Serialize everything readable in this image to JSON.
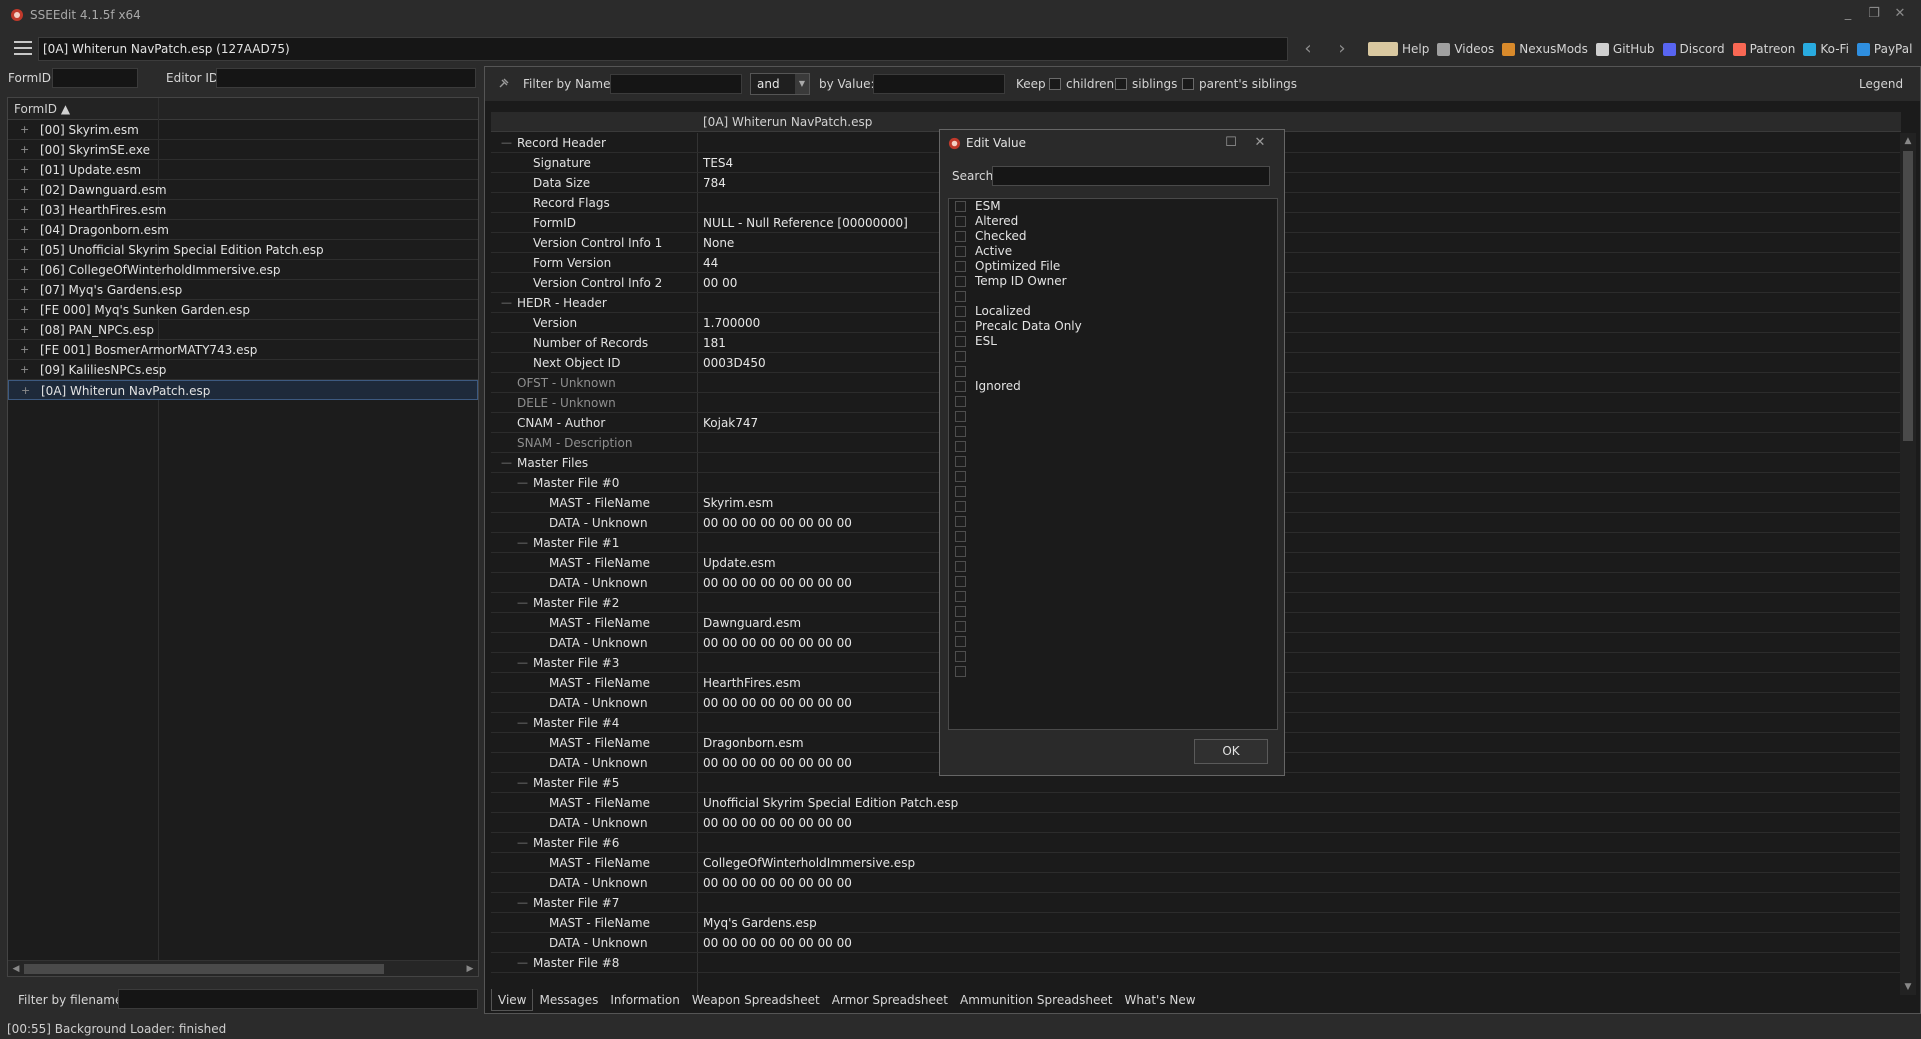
{
  "window": {
    "title": "SSEEdit 4.1.5f x64"
  },
  "toolbar": {
    "file_title": "[0A] Whiterun NavPatch.esp (127AAD75)",
    "links": [
      {
        "label": "Help",
        "icon": "book-icon",
        "color": "#d9c8a0"
      },
      {
        "label": "Videos",
        "icon": "video-icon",
        "color": "#a0a0a0"
      },
      {
        "label": "NexusMods",
        "icon": "nexus-icon",
        "color": "#d98a2b"
      },
      {
        "label": "GitHub",
        "icon": "github-icon",
        "color": "#cfcfcf"
      },
      {
        "label": "Discord",
        "icon": "discord-icon",
        "color": "#5865f2"
      },
      {
        "label": "Patreon",
        "icon": "patreon-icon",
        "color": "#f96854"
      },
      {
        "label": "Ko-Fi",
        "icon": "kofi-icon",
        "color": "#29abe0"
      },
      {
        "label": "PayPal",
        "icon": "paypal-icon",
        "color": "#2f8fe0"
      }
    ]
  },
  "left": {
    "formid_label": "FormID",
    "editorid_label": "Editor ID",
    "tree_header": "FormID ▲",
    "files": [
      "[00] Skyrim.esm",
      "[00] SkyrimSE.exe",
      "[01] Update.esm",
      "[02] Dawnguard.esm",
      "[03] HearthFires.esm",
      "[04] Dragonborn.esm",
      "[05] Unofficial Skyrim Special Edition Patch.esp",
      "[06] CollegeOfWinterholdImmersive.esp",
      "[07] Myq's Gardens.esp",
      "[FE 000] Myq's Sunken Garden.esp",
      "[08] PAN_NPCs.esp",
      "[FE 001] BosmerArmorMATY743.esp",
      "[09] KaliliesNPCs.esp",
      "[0A] Whiterun NavPatch.esp"
    ],
    "selected_index": 13,
    "filter_filename_label": "Filter by filename:"
  },
  "status": "[00:55] Background Loader: finished",
  "right": {
    "filter_by_name": "Filter by Name:",
    "combo_value": "and",
    "by_value": "by Value:",
    "keep": "Keep",
    "children": "children",
    "siblings": "siblings",
    "parents_siblings": "parent's siblings",
    "legend": "Legend",
    "column_header": "[0A] Whiterun NavPatch.esp",
    "rows": [
      {
        "label": "Record Header",
        "value": "",
        "indent": 0,
        "dim": false,
        "toggle": "—"
      },
      {
        "label": "Signature",
        "value": "TES4",
        "indent": 1,
        "dim": false,
        "toggle": ""
      },
      {
        "label": "Data Size",
        "value": "784",
        "indent": 1,
        "dim": false,
        "toggle": ""
      },
      {
        "label": "Record Flags",
        "value": "",
        "indent": 1,
        "dim": false,
        "toggle": ""
      },
      {
        "label": "FormID",
        "value": "NULL - Null Reference [00000000]",
        "indent": 1,
        "dim": false,
        "toggle": ""
      },
      {
        "label": "Version Control Info 1",
        "value": "None",
        "indent": 1,
        "dim": false,
        "toggle": ""
      },
      {
        "label": "Form Version",
        "value": "44",
        "indent": 1,
        "dim": false,
        "toggle": ""
      },
      {
        "label": "Version Control Info 2",
        "value": "00 00",
        "indent": 1,
        "dim": false,
        "toggle": ""
      },
      {
        "label": "HEDR - Header",
        "value": "",
        "indent": 0,
        "dim": false,
        "toggle": "—"
      },
      {
        "label": "Version",
        "value": "1.700000",
        "indent": 1,
        "dim": false,
        "toggle": ""
      },
      {
        "label": "Number of Records",
        "value": "181",
        "indent": 1,
        "dim": false,
        "toggle": ""
      },
      {
        "label": "Next Object ID",
        "value": "0003D450",
        "indent": 1,
        "dim": false,
        "toggle": ""
      },
      {
        "label": "OFST - Unknown",
        "value": "",
        "indent": 0,
        "dim": true,
        "toggle": ""
      },
      {
        "label": "DELE - Unknown",
        "value": "",
        "indent": 0,
        "dim": true,
        "toggle": ""
      },
      {
        "label": "CNAM - Author",
        "value": "Kojak747",
        "indent": 0,
        "dim": false,
        "toggle": ""
      },
      {
        "label": "SNAM - Description",
        "value": "",
        "indent": 0,
        "dim": true,
        "toggle": ""
      },
      {
        "label": "Master Files",
        "value": "",
        "indent": 0,
        "dim": false,
        "toggle": "—"
      },
      {
        "label": "Master File #0",
        "value": "",
        "indent": 1,
        "dim": false,
        "toggle": "—"
      },
      {
        "label": "MAST - FileName",
        "value": "Skyrim.esm",
        "indent": 2,
        "dim": false,
        "toggle": ""
      },
      {
        "label": "DATA - Unknown",
        "value": "00 00 00 00 00 00 00 00",
        "indent": 2,
        "dim": false,
        "toggle": ""
      },
      {
        "label": "Master File #1",
        "value": "",
        "indent": 1,
        "dim": false,
        "toggle": "—"
      },
      {
        "label": "MAST - FileName",
        "value": "Update.esm",
        "indent": 2,
        "dim": false,
        "toggle": ""
      },
      {
        "label": "DATA - Unknown",
        "value": "00 00 00 00 00 00 00 00",
        "indent": 2,
        "dim": false,
        "toggle": ""
      },
      {
        "label": "Master File #2",
        "value": "",
        "indent": 1,
        "dim": false,
        "toggle": "—"
      },
      {
        "label": "MAST - FileName",
        "value": "Dawnguard.esm",
        "indent": 2,
        "dim": false,
        "toggle": ""
      },
      {
        "label": "DATA - Unknown",
        "value": "00 00 00 00 00 00 00 00",
        "indent": 2,
        "dim": false,
        "toggle": ""
      },
      {
        "label": "Master File #3",
        "value": "",
        "indent": 1,
        "dim": false,
        "toggle": "—"
      },
      {
        "label": "MAST - FileName",
        "value": "HearthFires.esm",
        "indent": 2,
        "dim": false,
        "toggle": ""
      },
      {
        "label": "DATA - Unknown",
        "value": "00 00 00 00 00 00 00 00",
        "indent": 2,
        "dim": false,
        "toggle": ""
      },
      {
        "label": "Master File #4",
        "value": "",
        "indent": 1,
        "dim": false,
        "toggle": "—"
      },
      {
        "label": "MAST - FileName",
        "value": "Dragonborn.esm",
        "indent": 2,
        "dim": false,
        "toggle": ""
      },
      {
        "label": "DATA - Unknown",
        "value": "00 00 00 00 00 00 00 00",
        "indent": 2,
        "dim": false,
        "toggle": ""
      },
      {
        "label": "Master File #5",
        "value": "",
        "indent": 1,
        "dim": false,
        "toggle": "—"
      },
      {
        "label": "MAST - FileName",
        "value": "Unofficial Skyrim Special Edition Patch.esp",
        "indent": 2,
        "dim": false,
        "toggle": ""
      },
      {
        "label": "DATA - Unknown",
        "value": "00 00 00 00 00 00 00 00",
        "indent": 2,
        "dim": false,
        "toggle": ""
      },
      {
        "label": "Master File #6",
        "value": "",
        "indent": 1,
        "dim": false,
        "toggle": "—"
      },
      {
        "label": "MAST - FileName",
        "value": "CollegeOfWinterholdImmersive.esp",
        "indent": 2,
        "dim": false,
        "toggle": ""
      },
      {
        "label": "DATA - Unknown",
        "value": "00 00 00 00 00 00 00 00",
        "indent": 2,
        "dim": false,
        "toggle": ""
      },
      {
        "label": "Master File #7",
        "value": "",
        "indent": 1,
        "dim": false,
        "toggle": "—"
      },
      {
        "label": "MAST - FileName",
        "value": "Myq's Gardens.esp",
        "indent": 2,
        "dim": false,
        "toggle": ""
      },
      {
        "label": "DATA - Unknown",
        "value": "00 00 00 00 00 00 00 00",
        "indent": 2,
        "dim": false,
        "toggle": ""
      },
      {
        "label": "Master File #8",
        "value": "",
        "indent": 1,
        "dim": false,
        "toggle": "—"
      }
    ],
    "tabs": [
      "View",
      "Messages",
      "Information",
      "Weapon Spreadsheet",
      "Armor Spreadsheet",
      "Ammunition Spreadsheet",
      "What's New"
    ],
    "active_tab": 0
  },
  "dialog": {
    "title": "Edit Value",
    "search_label": "Search",
    "flags": [
      "ESM",
      "Altered",
      "Checked",
      "Active",
      "Optimized File",
      "Temp ID Owner",
      "",
      "Localized",
      "Precalc Data Only",
      "ESL",
      "",
      "",
      "Ignored",
      "",
      "",
      "",
      "",
      "",
      "",
      "",
      "",
      "",
      "",
      "",
      "",
      "",
      "",
      "",
      "",
      "",
      "",
      ""
    ],
    "ok_label": "OK"
  }
}
